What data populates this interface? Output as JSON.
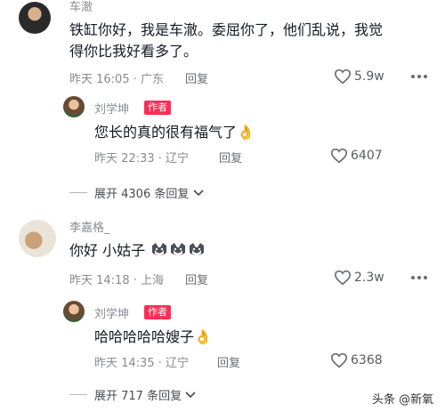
{
  "comments": [
    {
      "username": "车澈",
      "text_line1": "铁缸你好，我是车澈。委屈你了，他们乱说，我觉",
      "text_line2": "得你比我好看多了。",
      "time": "昨天 16:05 · 广东",
      "reply_label": "回复",
      "likes": "5.9w",
      "reply": {
        "username": "刘学坤",
        "badge": "作者",
        "text": "您长的真的很有福气了",
        "emoji": "👌",
        "time": "昨天 22:33 · 辽宁",
        "reply_label": "回复",
        "likes": "6407"
      },
      "expand_label": "展开 4306 条回复"
    },
    {
      "username": "李嘉格_",
      "text": "你好 小姑子",
      "time": "昨天 14:18 · 上海",
      "reply_label": "回复",
      "likes": "2.3w",
      "reply": {
        "username": "刘学坤",
        "badge": "作者",
        "text": "哈哈哈哈哈嫂子",
        "emoji": "👌",
        "time": "昨天 14:35 · 辽宁",
        "reply_label": "回复",
        "likes": "6368"
      },
      "expand_label": "展开 717 条回复"
    }
  ],
  "watermark": "头条 @新氧",
  "icons": {
    "heart": "heart-outline-icon",
    "more": "more-dots-icon",
    "chevron": "chevron-down-icon",
    "dog_emoji": "husky-emoji-icon"
  },
  "colors": {
    "badge": "#fe2c55",
    "meta": "#8a8b91",
    "text": "#161823"
  }
}
